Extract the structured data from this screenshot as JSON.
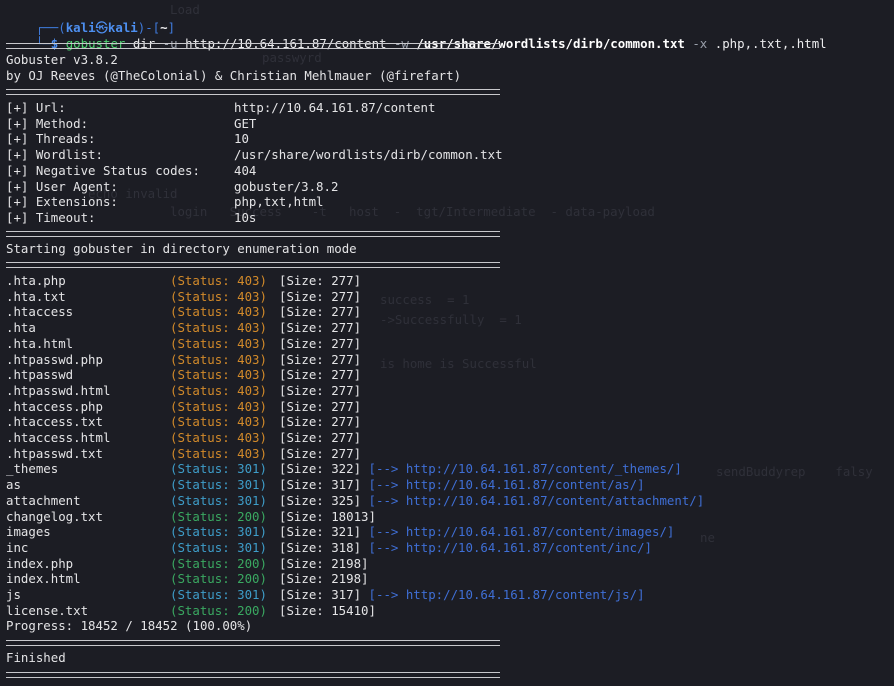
{
  "prompt": {
    "user": "kali",
    "at": "㉿",
    "host": "kali",
    "cwd": "~",
    "command_name": "gobuster",
    "command_args": [
      {
        "text": " dir ",
        "style": "normal"
      },
      {
        "text": "-u",
        "style": "grey"
      },
      {
        "text": " http://10.64.161.87/content ",
        "style": "normal"
      },
      {
        "text": "-w",
        "style": "grey"
      },
      {
        "text": " /usr/share/wordlists/dirb/common.txt",
        "style": "bold"
      },
      {
        "text": " -x",
        "style": "grey"
      },
      {
        "text": " .php,.txt,.html",
        "style": "normal"
      }
    ]
  },
  "banner": {
    "version": "Gobuster v3.8.2",
    "authors": "by OJ Reeves (@TheColonial) & Christian Mehlmauer (@firefart)"
  },
  "config": [
    {
      "key": "[+] Url:",
      "value": "http://10.64.161.87/content"
    },
    {
      "key": "[+] Method:",
      "value": "GET"
    },
    {
      "key": "[+] Threads:",
      "value": "10"
    },
    {
      "key": "[+] Wordlist:",
      "value": "/usr/share/wordlists/dirb/common.txt"
    },
    {
      "key": "[+] Negative Status codes:",
      "value": "404"
    },
    {
      "key": "[+] User Agent:",
      "value": "gobuster/3.8.2"
    },
    {
      "key": "[+] Extensions:",
      "value": "php,txt,html"
    },
    {
      "key": "[+] Timeout:",
      "value": "10s"
    }
  ],
  "mode_line": "Starting gobuster in directory enumeration mode",
  "results": [
    {
      "path": ".hta.php",
      "status": "403",
      "size": "277",
      "redirect": ""
    },
    {
      "path": ".hta.txt",
      "status": "403",
      "size": "277",
      "redirect": ""
    },
    {
      "path": ".htaccess",
      "status": "403",
      "size": "277",
      "redirect": ""
    },
    {
      "path": ".hta",
      "status": "403",
      "size": "277",
      "redirect": ""
    },
    {
      "path": ".hta.html",
      "status": "403",
      "size": "277",
      "redirect": ""
    },
    {
      "path": ".htpasswd.php",
      "status": "403",
      "size": "277",
      "redirect": ""
    },
    {
      "path": ".htpasswd",
      "status": "403",
      "size": "277",
      "redirect": ""
    },
    {
      "path": ".htpasswd.html",
      "status": "403",
      "size": "277",
      "redirect": ""
    },
    {
      "path": ".htaccess.php",
      "status": "403",
      "size": "277",
      "redirect": ""
    },
    {
      "path": ".htaccess.txt",
      "status": "403",
      "size": "277",
      "redirect": ""
    },
    {
      "path": ".htaccess.html",
      "status": "403",
      "size": "277",
      "redirect": ""
    },
    {
      "path": ".htpasswd.txt",
      "status": "403",
      "size": "277",
      "redirect": ""
    },
    {
      "path": "_themes",
      "status": "301",
      "size": "322",
      "redirect": "http://10.64.161.87/content/_themes/"
    },
    {
      "path": "as",
      "status": "301",
      "size": "317",
      "redirect": "http://10.64.161.87/content/as/"
    },
    {
      "path": "attachment",
      "status": "301",
      "size": "325",
      "redirect": "http://10.64.161.87/content/attachment/"
    },
    {
      "path": "changelog.txt",
      "status": "200",
      "size": "18013",
      "redirect": ""
    },
    {
      "path": "images",
      "status": "301",
      "size": "321",
      "redirect": "http://10.64.161.87/content/images/"
    },
    {
      "path": "inc",
      "status": "301",
      "size": "318",
      "redirect": "http://10.64.161.87/content/inc/"
    },
    {
      "path": "index.php",
      "status": "200",
      "size": "2198",
      "redirect": ""
    },
    {
      "path": "index.html",
      "status": "200",
      "size": "2198",
      "redirect": ""
    },
    {
      "path": "js",
      "status": "301",
      "size": "317",
      "redirect": "http://10.64.161.87/content/js/"
    },
    {
      "path": "license.txt",
      "status": "200",
      "size": "15410",
      "redirect": ""
    }
  ],
  "progress": "Progress: 18452 / 18452 (100.00%)",
  "finished": "Finished",
  "colors": {
    "background": "#1c1d24",
    "status_403": "#d28a2a",
    "status_301": "#3e9dc9",
    "status_200": "#3aa861",
    "redirect_link": "#3f6fd6",
    "prompt": "#4d8ff0"
  }
}
